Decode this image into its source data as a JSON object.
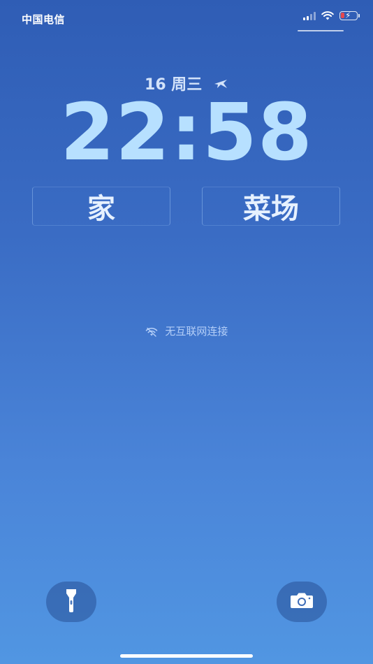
{
  "status_bar": {
    "carrier": "中国电信",
    "signal_icon": "cellular-signal-icon",
    "wifi_icon": "wifi-icon",
    "battery_icon": "battery-charging-icon",
    "battery_level": 0.25,
    "battery_fill_color": "#e5484d"
  },
  "lock_screen": {
    "date": "16 周三",
    "date_icon": "airplane-icon",
    "time": "22:58",
    "time_color": "#b7e0ff"
  },
  "widgets": [
    {
      "label": "家"
    },
    {
      "label": "菜场"
    }
  ],
  "network_status": {
    "icon": "wifi-off-icon",
    "text": "无互联网连接"
  },
  "quick_actions": {
    "flashlight_icon": "flashlight-icon",
    "camera_icon": "camera-icon"
  },
  "colors": {
    "background_top": "#2f5db5",
    "background_bottom": "#5196e2"
  }
}
